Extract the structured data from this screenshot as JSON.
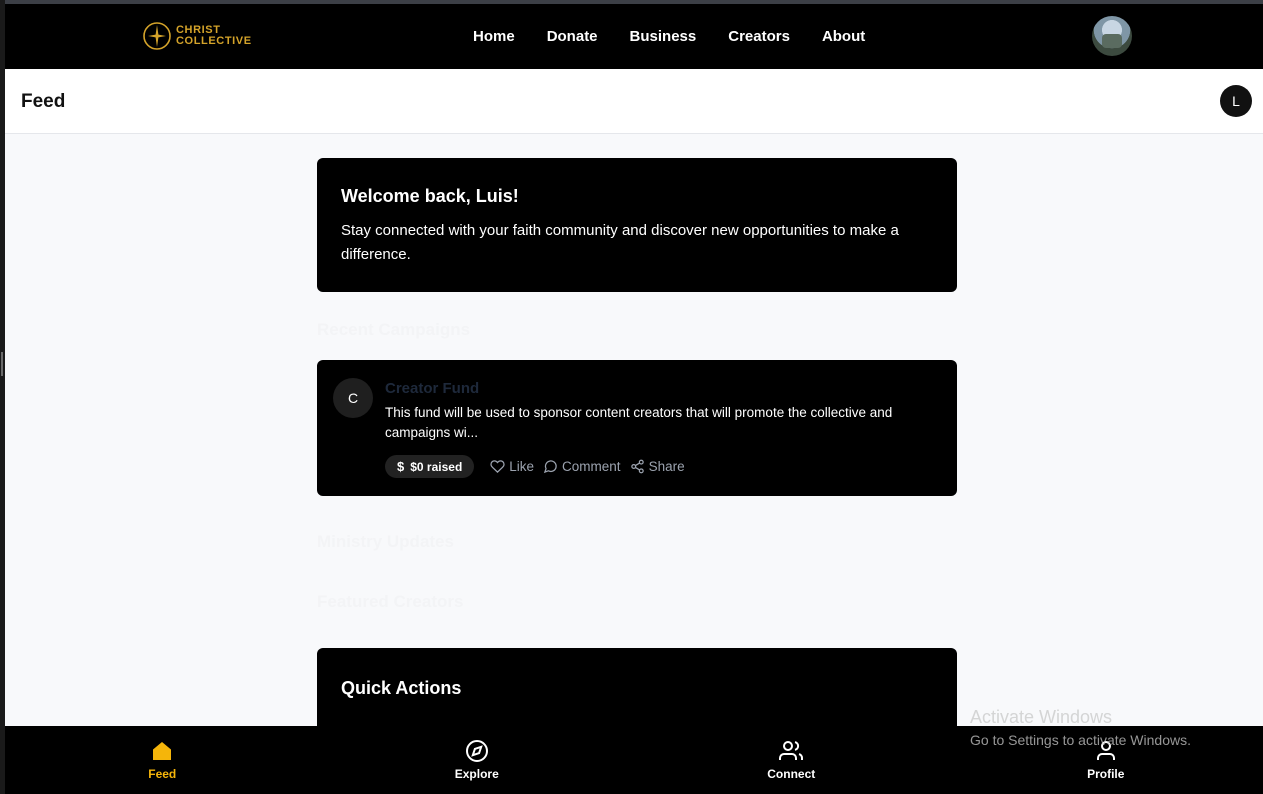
{
  "app": {
    "brand_line1": "CHRIST",
    "brand_line2": "COLLECTIVE",
    "brand_color": "#d4a32a"
  },
  "topnav": {
    "links": [
      "Home",
      "Donate",
      "Business",
      "Creators",
      "About"
    ]
  },
  "subheader": {
    "title": "Feed",
    "user_initial": "L"
  },
  "welcome": {
    "heading": "Welcome back, Luis!",
    "message": "Stay connected with your faith community and discover new opportunities to make a difference."
  },
  "sections": {
    "recent_campaigns": "Recent Campaigns",
    "ministry_updates": "Ministry Updates",
    "featured_creators": "Featured Creators"
  },
  "campaign": {
    "avatar_initial": "C",
    "title": "Creator Fund",
    "description": "This fund will be used to sponsor content creators that will promote the collective and campaigns wi...",
    "currency_symbol": "$",
    "raised": "$0 raised",
    "actions": {
      "like": "Like",
      "comment": "Comment",
      "share": "Share"
    }
  },
  "quick_actions": {
    "heading": "Quick Actions"
  },
  "bottomnav": {
    "items": [
      {
        "label": "Feed",
        "icon": "home-icon",
        "active": true
      },
      {
        "label": "Explore",
        "icon": "compass-icon",
        "active": false
      },
      {
        "label": "Connect",
        "icon": "users-icon",
        "active": false
      },
      {
        "label": "Profile",
        "icon": "user-icon",
        "active": false
      }
    ],
    "active_color": "#f5b50a"
  },
  "watermark": {
    "line1": "Activate Windows",
    "line2": "Go to Settings to activate Windows."
  }
}
